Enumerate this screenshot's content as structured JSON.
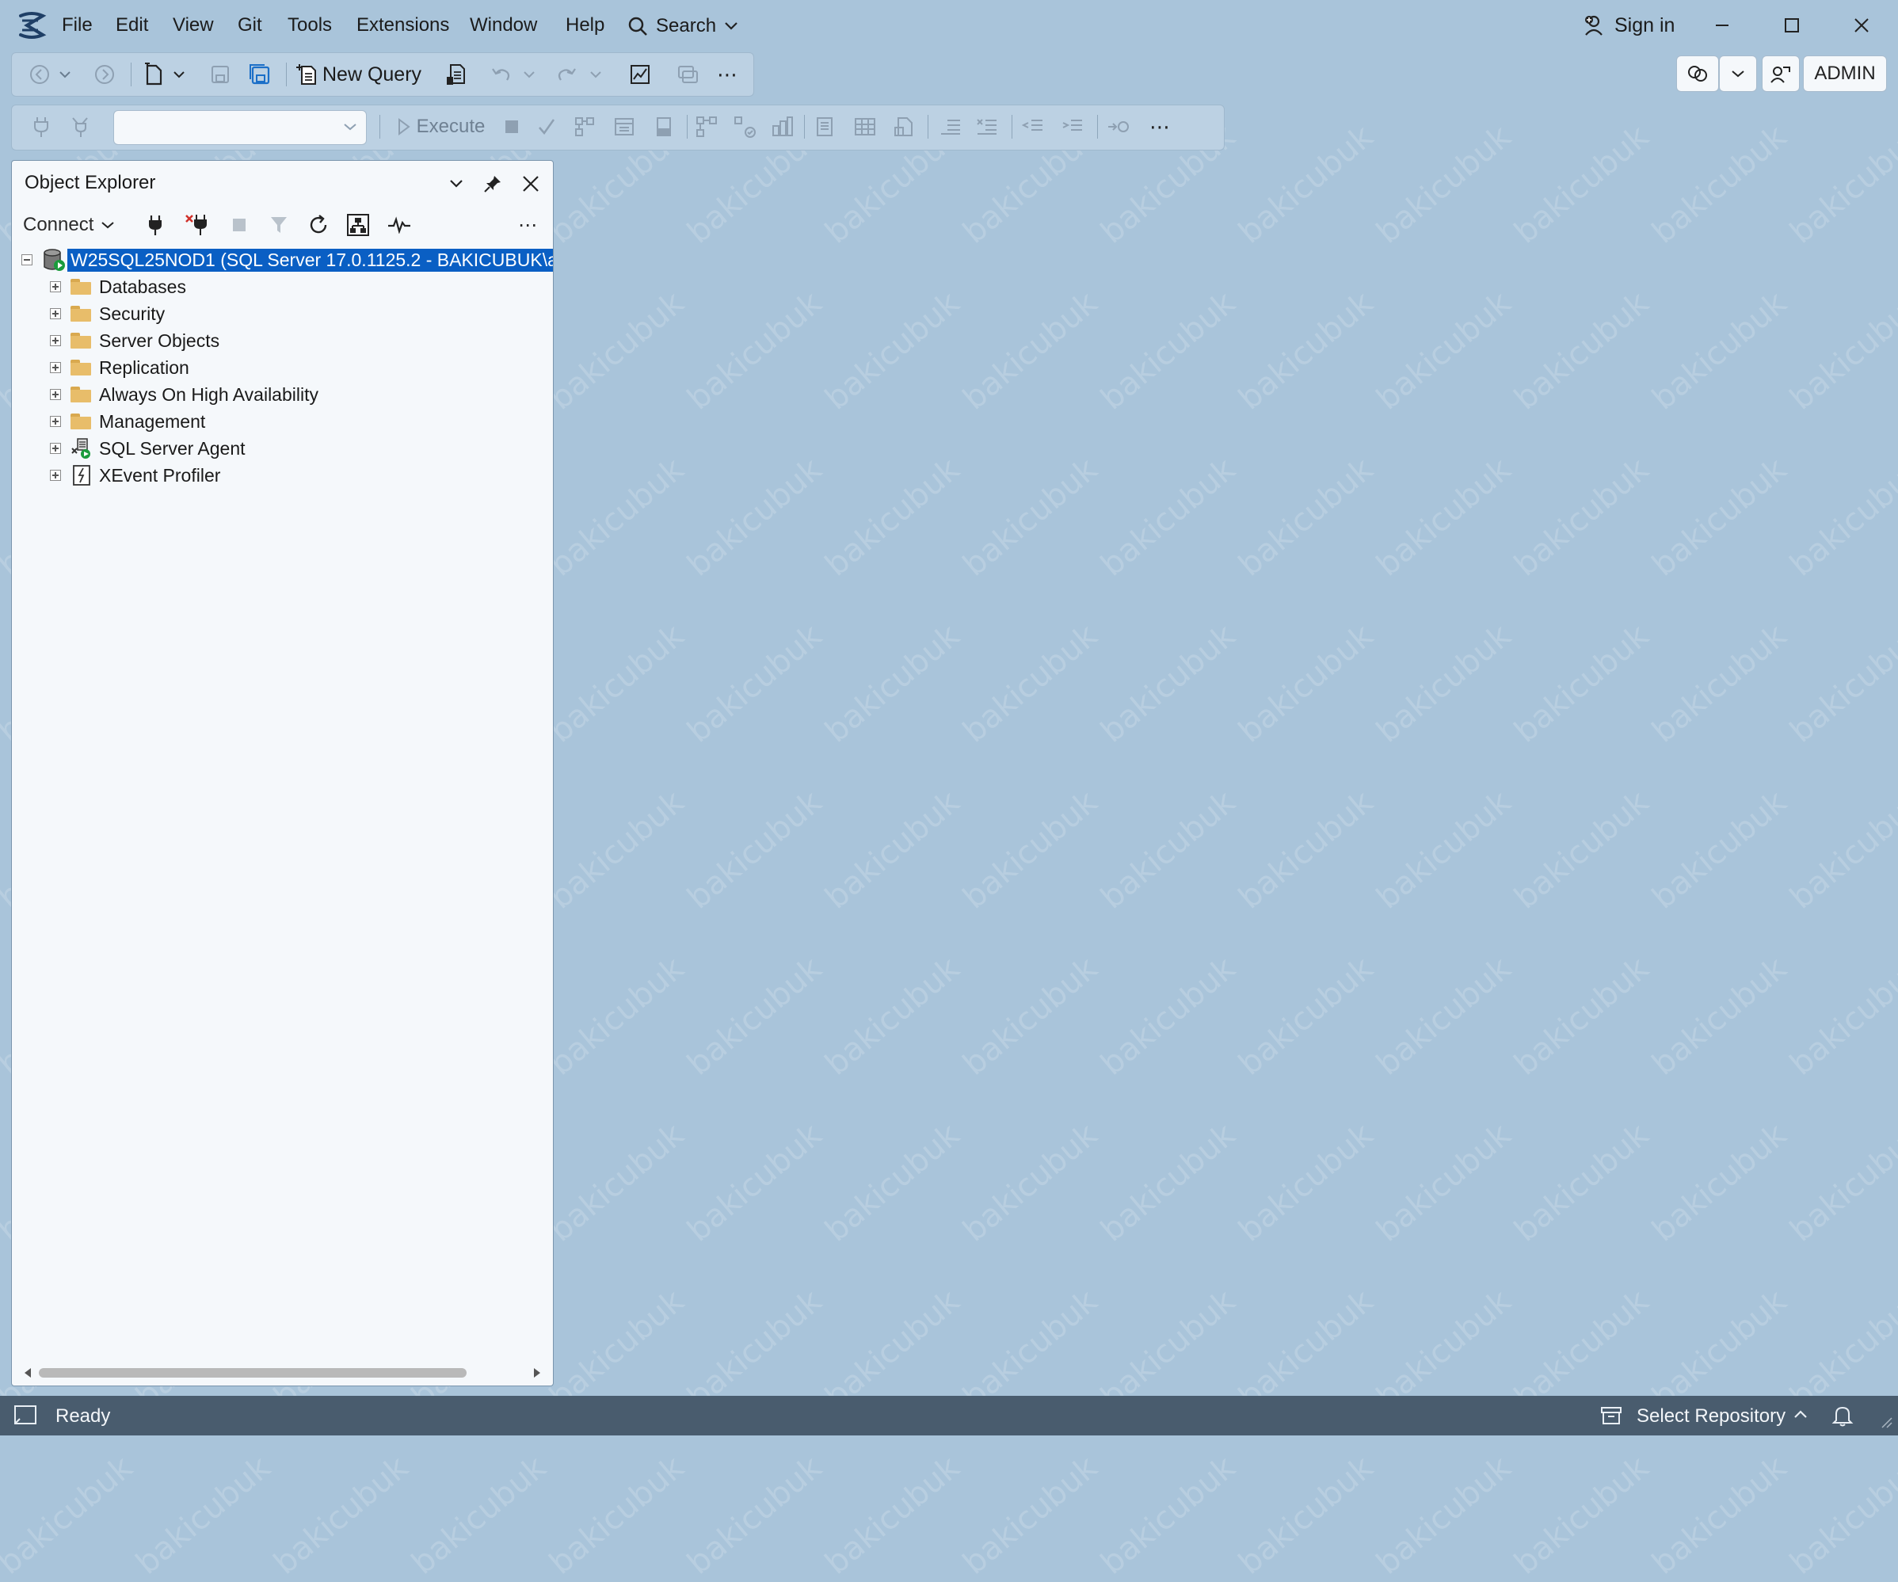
{
  "menu": {
    "items": [
      "File",
      "Edit",
      "View",
      "Git",
      "Tools",
      "Extensions",
      "Window",
      "Help"
    ],
    "search_label": "Search",
    "sign_in": "Sign in"
  },
  "toolbar1": {
    "new_query": "New Query"
  },
  "toolbar2": {
    "database_combo_value": "",
    "execute": "Execute"
  },
  "toolbar_right": {
    "admin": "ADMIN"
  },
  "object_explorer": {
    "title": "Object Explorer",
    "connect": "Connect",
    "server_node": "W25SQL25NOD1 (SQL Server 17.0.1125.2 - BAKICUBUK\\a",
    "children": [
      "Databases",
      "Security",
      "Server Objects",
      "Replication",
      "Always On High Availability",
      "Management",
      "SQL Server Agent",
      "XEvent Profiler"
    ]
  },
  "statusbar": {
    "status": "Ready",
    "repository": "Select Repository"
  },
  "watermark": "bakicubuk",
  "colors": {
    "background": "#a9c4da",
    "selection": "#0a5fc4",
    "statusbar": "#495c6e"
  }
}
